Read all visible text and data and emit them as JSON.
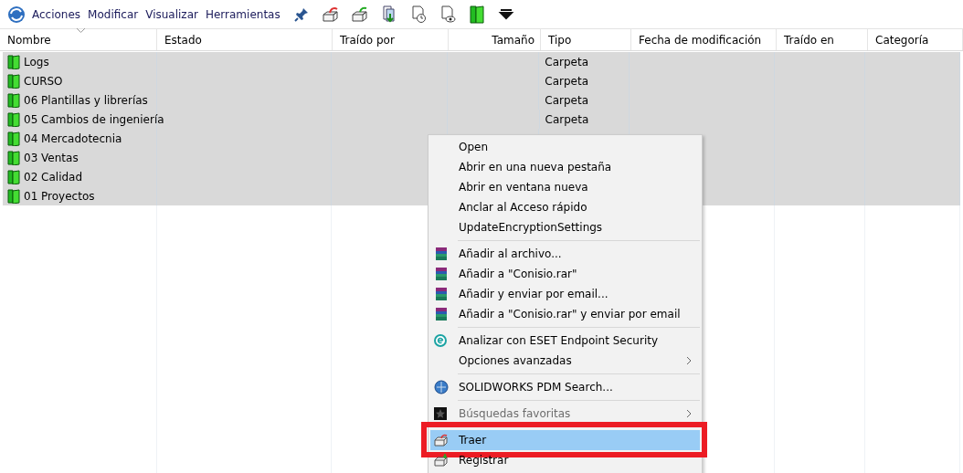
{
  "menubar": [
    "Acciones",
    "Modificar",
    "Visualizar",
    "Herramientas"
  ],
  "columns": [
    {
      "label": "Nombre",
      "numeric": false,
      "sorted": true
    },
    {
      "label": "Estado",
      "numeric": false,
      "sorted": false
    },
    {
      "label": "Traído por",
      "numeric": false,
      "sorted": false
    },
    {
      "label": "Tamaño",
      "numeric": true,
      "sorted": false
    },
    {
      "label": "Tipo",
      "numeric": false,
      "sorted": false
    },
    {
      "label": "Fecha de modificación",
      "numeric": false,
      "sorted": false
    },
    {
      "label": "Traído en",
      "numeric": false,
      "sorted": false
    },
    {
      "label": "Categoría",
      "numeric": false,
      "sorted": false
    }
  ],
  "rows": [
    {
      "name": "Logs",
      "type": "Carpeta",
      "selected": true
    },
    {
      "name": "CURSO",
      "type": "Carpeta",
      "selected": true
    },
    {
      "name": "06 Plantillas y librerías",
      "type": "Carpeta",
      "selected": true
    },
    {
      "name": "05 Cambios de ingeniería",
      "type": "Carpeta",
      "selected": true
    },
    {
      "name": "04 Mercadotecnia",
      "selected": true
    },
    {
      "name": "03 Ventas",
      "selected": true
    },
    {
      "name": "02 Calidad",
      "selected": true
    },
    {
      "name": "01 Proyectos",
      "selected": true
    }
  ],
  "context_menu": [
    {
      "kind": "item",
      "label": "Open"
    },
    {
      "kind": "item",
      "label": "Abrir en una nueva pestaña"
    },
    {
      "kind": "item",
      "label": "Abrir en ventana nueva"
    },
    {
      "kind": "item",
      "label": "Anclar al Acceso rápido"
    },
    {
      "kind": "item",
      "label": "UpdateEncryptionSettings"
    },
    {
      "kind": "separator"
    },
    {
      "kind": "archive",
      "label": "Añadir al archivo..."
    },
    {
      "kind": "archive",
      "label": "Añadir a \"Conisio.rar\""
    },
    {
      "kind": "archive",
      "label": "Añadir y enviar por email..."
    },
    {
      "kind": "archive",
      "label": "Añadir a \"Conisio.rar\" y enviar por email"
    },
    {
      "kind": "separator"
    },
    {
      "kind": "eset",
      "label": "Analizar con ESET Endpoint Security"
    },
    {
      "kind": "item",
      "label": "Opciones avanzadas",
      "submenu": true
    },
    {
      "kind": "separator"
    },
    {
      "kind": "search",
      "label": "SOLIDWORKS PDM Search..."
    },
    {
      "kind": "separator"
    },
    {
      "kind": "star",
      "label": "Búsquedas favoritas",
      "submenu": true,
      "disabled": true
    },
    {
      "kind": "separator"
    },
    {
      "kind": "getbox",
      "label": "Traer",
      "selected": true,
      "highlighted": true
    },
    {
      "kind": "checkin",
      "label": "Registrar"
    }
  ]
}
